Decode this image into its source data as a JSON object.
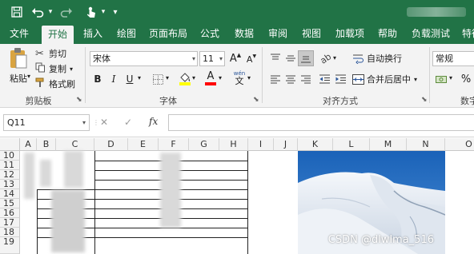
{
  "quick_access": {
    "save_icon": "save-icon",
    "undo_icon": "undo-icon",
    "redo_icon": "redo-icon",
    "touch_icon": "touch-mode-icon",
    "more": "▾"
  },
  "tabs": [
    {
      "label": "文件"
    },
    {
      "label": "开始"
    },
    {
      "label": "插入"
    },
    {
      "label": "绘图"
    },
    {
      "label": "页面布局"
    },
    {
      "label": "公式"
    },
    {
      "label": "数据"
    },
    {
      "label": "审阅"
    },
    {
      "label": "视图"
    },
    {
      "label": "加载项"
    },
    {
      "label": "帮助"
    },
    {
      "label": "负载测试"
    },
    {
      "label": "特征"
    }
  ],
  "ribbon": {
    "clipboard": {
      "paste": "粘贴",
      "cut": "剪切",
      "copy": "复制",
      "format_painter": "格式刷",
      "group_label": "剪贴板"
    },
    "font": {
      "font_name": "宋体",
      "font_size": "11",
      "grow": "A",
      "shrink": "A",
      "bold": "B",
      "italic": "I",
      "underline": "U",
      "phonetic_top": "wén",
      "phonetic_bottom": "文",
      "group_label": "字体"
    },
    "alignment": {
      "wrap_text": "自动换行",
      "merge_center": "合并后居中",
      "group_label": "对齐方式"
    },
    "number": {
      "format": "常规",
      "percent": "%",
      "group_label": "数字"
    },
    "colors": {
      "accent": "#217346",
      "highlight": "#ffff00",
      "font_color": "#ff0000"
    }
  },
  "formula_bar": {
    "name_box": "Q11",
    "cancel": "✕",
    "enter": "✓",
    "fx": "fx",
    "formula": ""
  },
  "columns": [
    "A",
    "B",
    "C",
    "D",
    "E",
    "F",
    "G",
    "H",
    "I",
    "J",
    "K",
    "L",
    "M",
    "N",
    "O"
  ],
  "rows": [
    "10",
    "11",
    "12",
    "13",
    "14",
    "15",
    "16",
    "17",
    "18",
    "19"
  ],
  "watermark": "CSDN @dlwlma_516"
}
